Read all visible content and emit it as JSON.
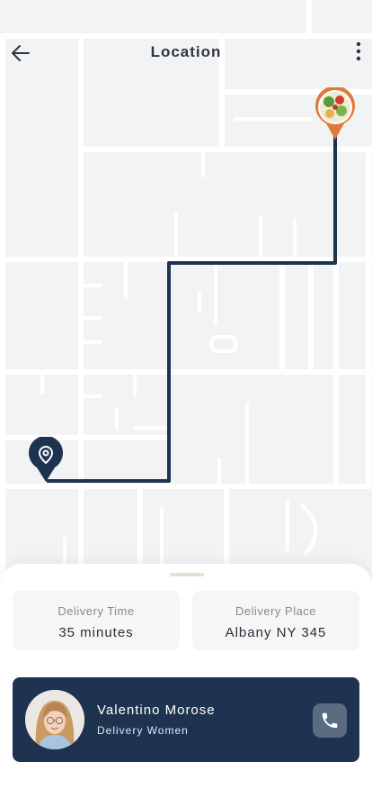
{
  "header": {
    "title": "Location",
    "back_icon": "arrow-left-icon",
    "more_icon": "more-vertical-icon"
  },
  "map": {
    "route_color": "#1e3350",
    "restaurant_pin_color": "#e07a3a",
    "destination_pin_color": "#1e3350"
  },
  "delivery_info": [
    {
      "label": "Delivery Time",
      "value": "35 minutes"
    },
    {
      "label": "Delivery Place",
      "value": "Albany NY 345"
    }
  ],
  "courier": {
    "name": "Valentino Morose",
    "role": "Delivery Women",
    "call_icon": "phone-icon",
    "card_color": "#1e3350"
  }
}
